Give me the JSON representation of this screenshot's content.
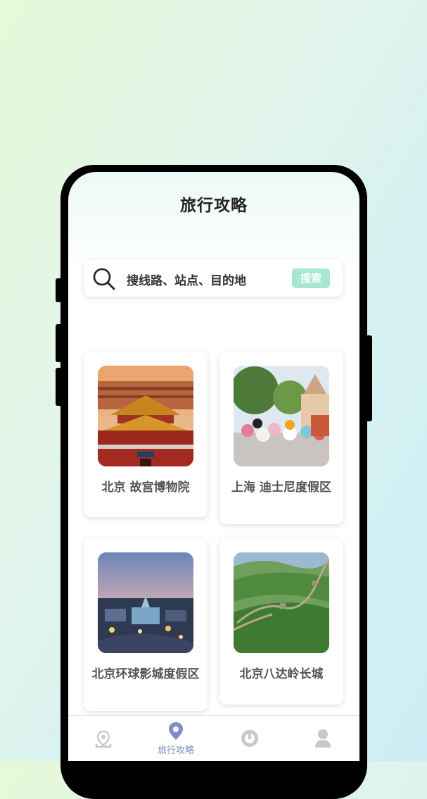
{
  "header": {
    "title": "旅行攻略"
  },
  "search": {
    "placeholder": "搜线路、站点、目的地",
    "button_label": "搜索"
  },
  "cards": [
    {
      "label": "北京 故宫博物院"
    },
    {
      "label": "上海 迪士尼度假区"
    },
    {
      "label": "北京环球影城度假区"
    },
    {
      "label": "北京八达岭长城"
    }
  ],
  "tabs": [
    {
      "icon": "location-pin-icon",
      "label": ""
    },
    {
      "icon": "map-marker-icon",
      "label": "旅行攻略",
      "active": true
    },
    {
      "icon": "compass-icon",
      "label": ""
    },
    {
      "icon": "user-icon",
      "label": ""
    }
  ],
  "colors": {
    "accent": "#a9e6d2",
    "tab_active": "#7a8fc7",
    "tab_inactive": "#c8c8c8"
  }
}
